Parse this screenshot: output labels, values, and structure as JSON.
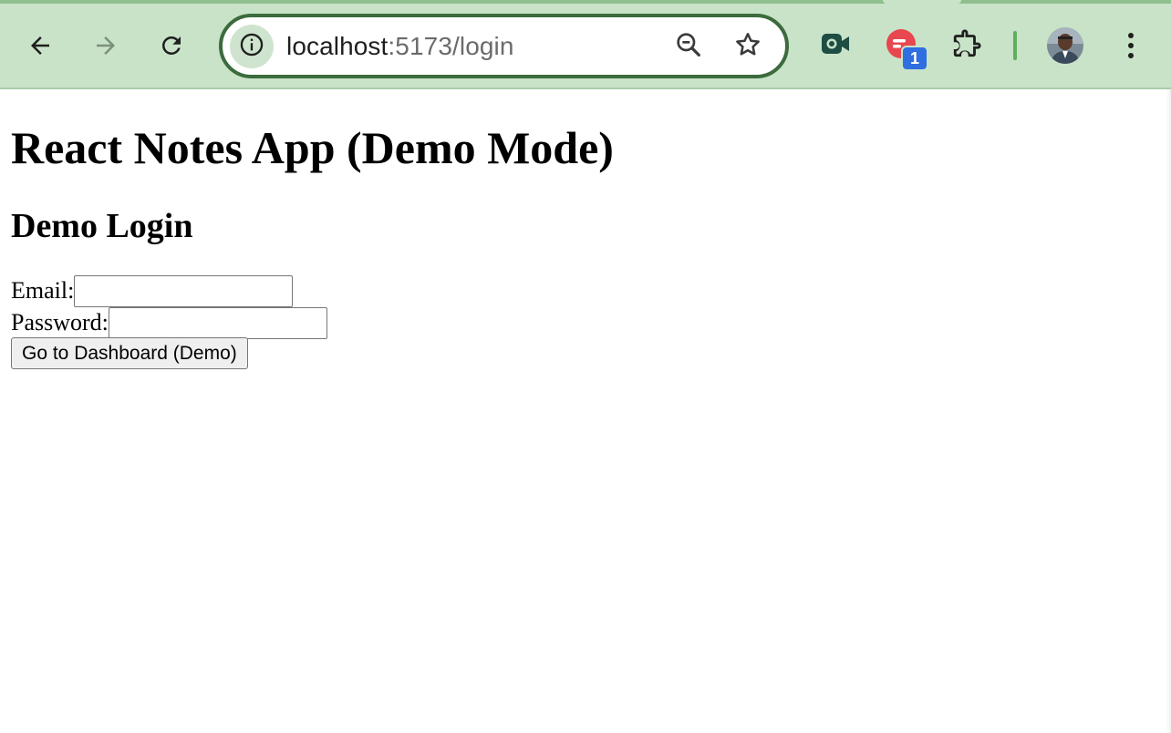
{
  "browser": {
    "url_host": "localhost",
    "url_path": ":5173/login",
    "extension_badge_count": "1",
    "toolbar_color": "#c9e3c8",
    "icons": {
      "back": "arrow-left-icon",
      "forward": "arrow-right-icon",
      "reload": "reload-icon",
      "site_info": "info-icon",
      "zoom": "zoom-out-icon",
      "bookmark": "star-icon",
      "extension_1": "camera-extension-icon",
      "extension_2": "notification-extension-icon",
      "extensions": "puzzle-piece-icon",
      "menu": "kebab-menu-icon"
    }
  },
  "page": {
    "title": "React Notes App (Demo Mode)",
    "login_heading": "Demo Login",
    "email_label": "Email:",
    "email_value": "",
    "password_label": "Password:",
    "password_value": "",
    "submit_label": "Go to Dashboard (Demo)"
  }
}
